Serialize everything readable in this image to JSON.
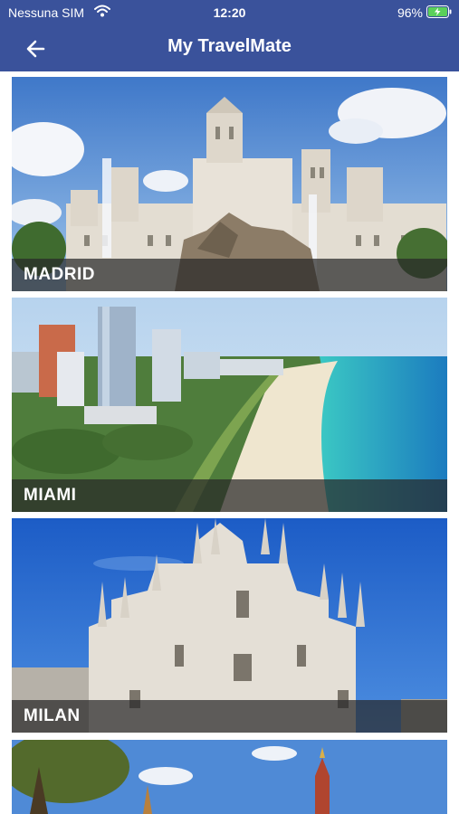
{
  "status_bar": {
    "carrier": "Nessuna SIM",
    "time": "12:20",
    "battery_percent": "96%"
  },
  "header": {
    "title": "My TravelMate",
    "back_icon": "arrow-left-icon",
    "background_color": "#3a529b"
  },
  "destinations": [
    {
      "name": "MADRID"
    },
    {
      "name": "MIAMI"
    },
    {
      "name": "MILAN"
    }
  ]
}
